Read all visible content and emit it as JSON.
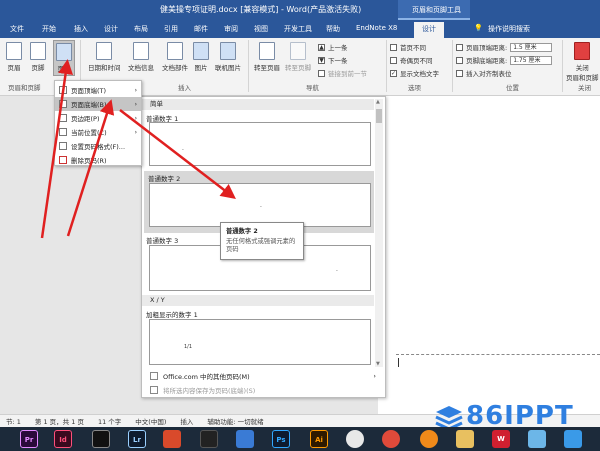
{
  "titlebar": {
    "title": "健美操专项证明.docx [兼容模式] - Word(产品激活失败)",
    "context_tab_group": "页眉和页脚工具"
  },
  "tabs": [
    "文件",
    "开始",
    "插入",
    "设计",
    "布局",
    "引用",
    "邮件",
    "审阅",
    "视图",
    "开发工具",
    "帮助",
    "EndNote X8",
    "设计",
    "操作说明搜索"
  ],
  "ribbon": {
    "header_footer_group": {
      "label": "页眉和页脚",
      "header": "页眉",
      "footer": "页脚",
      "page_number": "页码"
    },
    "insert_group": {
      "label": "插入",
      "datetime": "日期和时间",
      "docinfo": "文档信息",
      "parts": "文档部件",
      "picture": "图片",
      "online_picture": "联机图片"
    },
    "nav_group": {
      "label": "导航",
      "goto_header": "转至页眉",
      "goto_footer": "转至页脚",
      "prev": "上一条",
      "next": "下一条",
      "link_prev": "链接到前一节"
    },
    "options_group": {
      "label": "选项",
      "diff_first": "首页不同",
      "diff_odd_even": "奇偶页不同",
      "show_text": "显示文档文字",
      "show_text_checked": "✓"
    },
    "position_group": {
      "label": "位置",
      "header_dist": "页眉顶端距离:",
      "footer_dist": "页脚底端距离:",
      "header_val": "1.5 厘米",
      "footer_val": "1.75 厘米",
      "insert_align": "插入对齐制表位"
    },
    "close_group": {
      "label": "关闭",
      "close": "关闭",
      "close2": "页眉和页脚"
    }
  },
  "submenu": {
    "items": [
      {
        "label": "页面顶端(T)",
        "arrow": "›"
      },
      {
        "label": "页面底端(B)",
        "arrow": "›"
      },
      {
        "label": "页边距(P)",
        "arrow": "›"
      },
      {
        "label": "当前位置(C)",
        "arrow": "›"
      },
      {
        "label": "设置页码格式(F)..."
      },
      {
        "label": "删除页码(R)"
      }
    ]
  },
  "gallery": {
    "section1": "简单",
    "items": [
      {
        "title": "普通数字 1",
        "mark": "."
      },
      {
        "title": "普通数字 2",
        "mark": "."
      },
      {
        "title": "普通数字 3",
        "mark": "."
      }
    ],
    "section2": "X / Y",
    "item4": {
      "title": "加粗显示的数字 1",
      "mark": "1/1"
    },
    "footer1": "Office.com 中的其他页码(M)",
    "footer1_arrow": "›",
    "footer2": "将所选内容保存为页码(底端)(S)",
    "scroll_up": "▲",
    "scroll_down": "▼"
  },
  "tooltip": {
    "title": "普通数字 2",
    "desc": "无任何格式或强调元素的页码"
  },
  "statusbar": {
    "section": "节: 1",
    "page": "第 1 页，共 1 页",
    "words": "11 个字",
    "lang": "中文(中国)",
    "mode": "插入",
    "a11y": "辅助功能: 一切就绪"
  },
  "taskbar": {
    "apps": [
      "Pr",
      "Id",
      "",
      "Lr",
      "",
      "",
      "",
      "",
      "Ps",
      "Ai",
      "",
      "",
      "",
      "",
      "",
      "W",
      "",
      ""
    ]
  },
  "watermark": {
    "text": "86IPPT"
  },
  "colors": {
    "accent": "#2b579a",
    "arrow": "#e02020",
    "watermark": "#2f7fe0"
  }
}
